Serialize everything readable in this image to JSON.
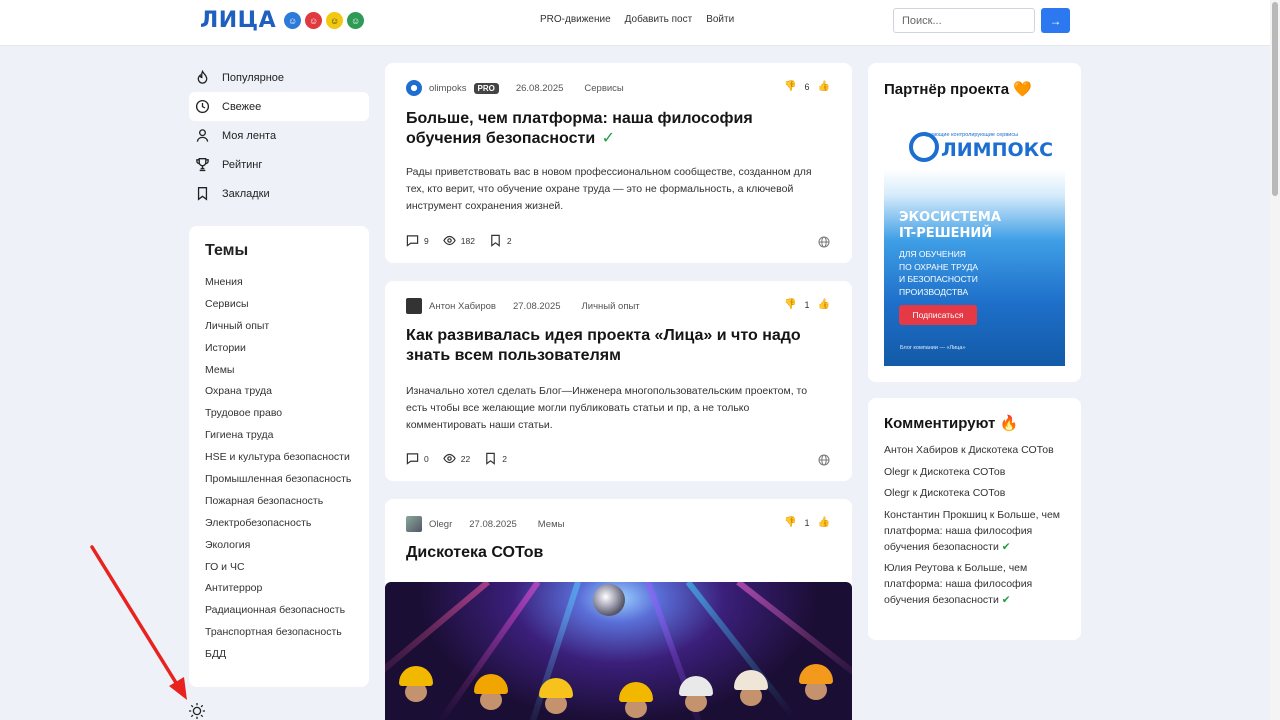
{
  "header": {
    "logo_text": "ЛИЦА",
    "nav": [
      "PRO-движение",
      "Добавить пост",
      "Войти"
    ],
    "search_placeholder": "Поиск...",
    "search_button": "→"
  },
  "sidebar": {
    "items": [
      {
        "label": "Популярное",
        "icon": "fire-icon"
      },
      {
        "label": "Свежее",
        "icon": "clock-icon",
        "active": true
      },
      {
        "label": "Моя лента",
        "icon": "user-icon"
      },
      {
        "label": "Рейтинг",
        "icon": "trophy-icon"
      },
      {
        "label": "Закладки",
        "icon": "bookmark-icon"
      }
    ]
  },
  "themes": {
    "title": "Темы",
    "items": [
      "Мнения",
      "Сервисы",
      "Личный опыт",
      "Истории",
      "Мемы",
      "Охрана труда",
      "Трудовое право",
      "Гигиена труда",
      "HSE и культура безопасности",
      "Промышленная безопасность",
      "Пожарная безопасность",
      "Электробезопасность",
      "Экология",
      "ГО и ЧС",
      "Антитеррор",
      "Радиационная безопасность",
      "Транспортная безопасность",
      "БДД"
    ]
  },
  "posts": [
    {
      "author": "olimpoks",
      "pro_badge": "PRO",
      "date": "26.08.2025",
      "category": "Сервисы",
      "votes": "6",
      "title": "Больше, чем платформа: наша философия обучения безопасности",
      "verified": "✓",
      "excerpt": "Рады приветствовать вас в новом профессиональном сообществе, созданном для тех, кто верит, что обучение охране труда — это не формальность, а ключевой инструмент сохранения жизней.",
      "comments": "9",
      "views": "182",
      "bookmarks": "2"
    },
    {
      "author": "Антон Хабиров",
      "date": "27.08.2025",
      "category": "Личный опыт",
      "votes": "1",
      "title": "Как развивалась идея проекта «Лица» и что надо знать всем пользователям",
      "excerpt": "Изначально хотел сделать Блог—Инженера многопользовательским проектом, то есть чтобы все желающие могли публиковать статьи и пр, а не только комментировать наши статьи.",
      "comments": "0",
      "views": "22",
      "bookmarks": "2"
    },
    {
      "author": "Olegr",
      "date": "27.08.2025",
      "category": "Мемы",
      "votes": "1",
      "title": "Дискотека СОТов"
    }
  ],
  "partner": {
    "title": "Партнёр проекта 🧡",
    "ad_tag": "обучающие контролирующие сервисы",
    "ad_logo": "ЛИМПОКС",
    "ad_headline": [
      "ЭКОСИСТЕМА",
      "IT-РЕШЕНИЙ"
    ],
    "ad_sub": [
      "ДЛЯ ОБУЧЕНИЯ",
      "ПО ОХРАНЕ ТРУДА",
      "И БЕЗОПАСНОСТИ",
      "ПРОИЗВОДСТВА"
    ],
    "ad_button": "Подписаться",
    "ad_footer": "Блог компании — «Лица»"
  },
  "comments_widget": {
    "title": "Комментируют 🔥",
    "items": [
      {
        "text": "Антон Хабиров к Дискотека СОТов",
        "check": ""
      },
      {
        "text": "Olegr к Дискотека СОТов",
        "check": ""
      },
      {
        "text": "Olegr к Дискотека СОТов",
        "check": ""
      },
      {
        "text": "Константин Прокшиц к Больше, чем платформа: наша философия обучения безопасности",
        "check": "✔"
      },
      {
        "text": "Юлия Реутова к Больше, чем платформа: наша философия обучения безопасности",
        "check": "✔"
      }
    ]
  },
  "colors": {
    "accent": "#2b78f0",
    "check": "#1e9e3e",
    "annotation_arrow": "#e8231f"
  }
}
